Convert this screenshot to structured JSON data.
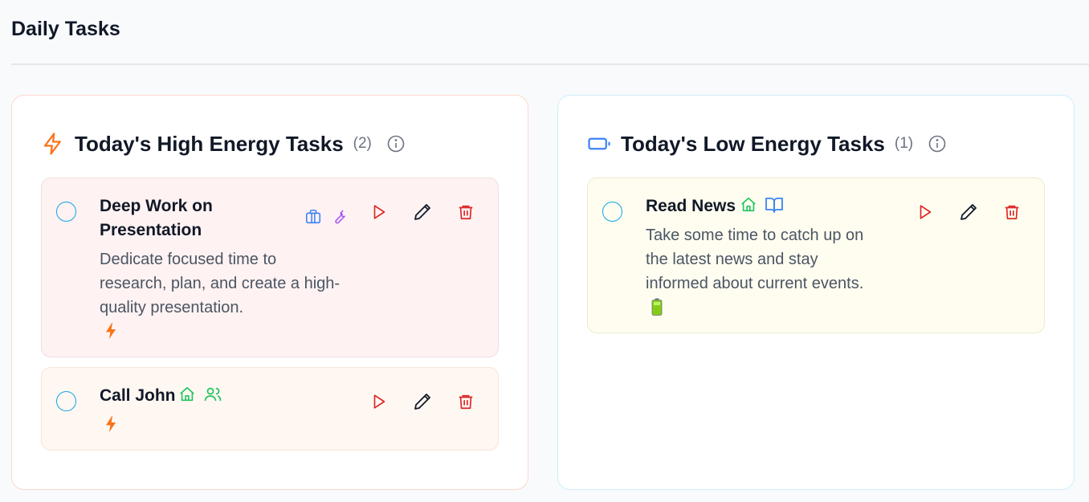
{
  "page": {
    "title": "Daily Tasks"
  },
  "colors": {
    "high_accent": "#f97316",
    "low_accent": "#3b82f6",
    "play": "#dc2626",
    "delete": "#dc2626",
    "edit": "#111827",
    "checkbox": "#0ea5e9",
    "tag_work": "#3b82f6",
    "tag_tools": "#a855f7",
    "tag_home": "#22c55e",
    "tag_people": "#22c55e",
    "tag_read": "#3b82f6"
  },
  "high_panel": {
    "title": "Today's High Energy Tasks",
    "count": "(2)",
    "icon": "lightning-icon",
    "tasks": [
      {
        "title_line1": "Deep Work on",
        "title_line2": "Presentation",
        "desc_line1": "Dedicate focused time to",
        "desc_line2": "research, plan, and create a high-",
        "desc_line3": "quality presentation.",
        "tags": [
          "briefcase-icon",
          "wrench-icon"
        ],
        "energy": "lightning-icon"
      },
      {
        "title": "Call John",
        "tags": [
          "home-icon",
          "users-icon"
        ],
        "energy": "lightning-icon"
      }
    ]
  },
  "low_panel": {
    "title": "Today's Low Energy Tasks",
    "count": "(1)",
    "icon": "battery-icon",
    "tasks": [
      {
        "title": "Read News",
        "desc_line1": "Take some time to catch up on",
        "desc_line2": "the latest news and stay",
        "desc_line3": "informed about current events.",
        "tags": [
          "home-icon",
          "book-icon"
        ],
        "energy": "battery-full-icon"
      }
    ]
  }
}
